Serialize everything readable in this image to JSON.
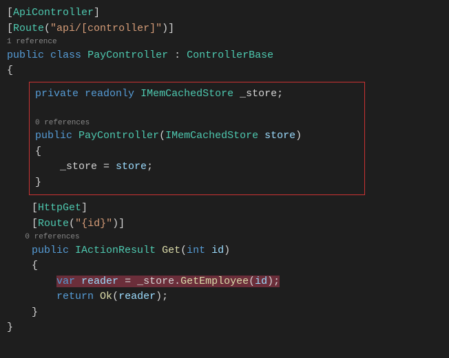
{
  "attr_api": "ApiController",
  "attr_route_kw": "Route",
  "attr_route_str": "\"api/[controller]\"",
  "ref1": "1 reference",
  "kw_public": "public",
  "kw_class": "class",
  "class_name": "PayController",
  "colon": " : ",
  "base_class": "ControllerBase",
  "brace_open": "{",
  "brace_close": "}",
  "kw_private": "private",
  "kw_readonly": "readonly",
  "field_type": "IMemCachedStore",
  "field_name": "_store",
  "semicolon": ";",
  "ref0a": "0 references",
  "ctor_name": "PayController",
  "ctor_param_type": "IMemCachedStore",
  "ctor_param_name": "store",
  "assign_left": "_store",
  "assign_eq": " = ",
  "assign_right": "store",
  "attr_httpget": "HttpGet",
  "attr_route2_str": "\"{id}\"",
  "ref0b": "0 references",
  "ret_type": "IActionResult",
  "method_name": "Get",
  "param_type": "int",
  "param_name": "id",
  "kw_var": "var",
  "reader": "reader",
  "store_ref": "_store",
  "get_emp": "GetEmployee",
  "id_arg": "id",
  "kw_return": "return",
  "ok_call": "Ok",
  "reader_arg": "reader"
}
